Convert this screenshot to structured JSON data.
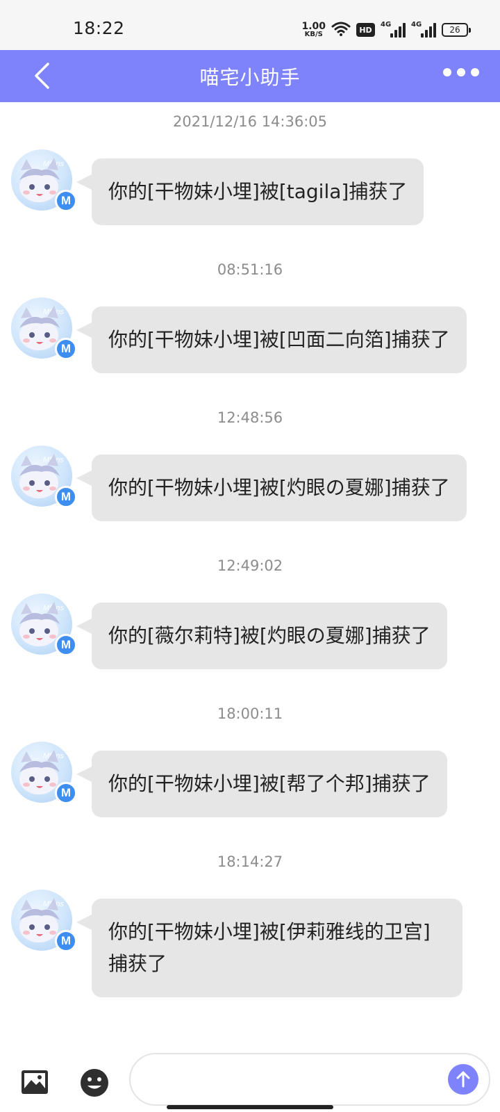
{
  "status_bar": {
    "time": "18:22",
    "net_speed_value": "1.00",
    "net_speed_unit": "KB/S",
    "hd_label": "HD",
    "signal1_label": "4G",
    "signal2_label": "4G",
    "battery_level": "26",
    "icons": [
      "wifi-icon",
      "hd-icon",
      "signal-icon",
      "signal-icon",
      "battery-icon"
    ]
  },
  "header": {
    "title": "喵宅小助手",
    "back_icon": "chevron-left-icon",
    "more_icon": "more-dots-icon",
    "background_color": "#7e83fb"
  },
  "avatar": {
    "logo_text": "Mfuns",
    "badge_letter": "M"
  },
  "messages": [
    {
      "timestamp": "2021/12/16 14:36:05",
      "text": "你的[干物妹小埋]被[tagila]捕获了"
    },
    {
      "timestamp": "08:51:16",
      "text": "你的[干物妹小埋]被[凹面二向箔]捕获了"
    },
    {
      "timestamp": "12:48:56",
      "text": "你的[干物妹小埋]被[灼眼の夏娜]捕获了"
    },
    {
      "timestamp": "12:49:02",
      "text": "你的[薇尔莉特]被[灼眼の夏娜]捕获了"
    },
    {
      "timestamp": "18:00:11",
      "text": "你的[干物妹小埋]被[帮了个邦]捕获了"
    },
    {
      "timestamp": "18:14:27",
      "text": "你的[干物妹小埋]被[伊莉雅线的卫宫]捕获了"
    }
  ],
  "input_bar": {
    "image_icon": "image-icon",
    "emoji_icon": "emoji-icon",
    "input_value": "",
    "send_icon": "arrow-up-icon",
    "accent_color": "#7e83fb"
  }
}
